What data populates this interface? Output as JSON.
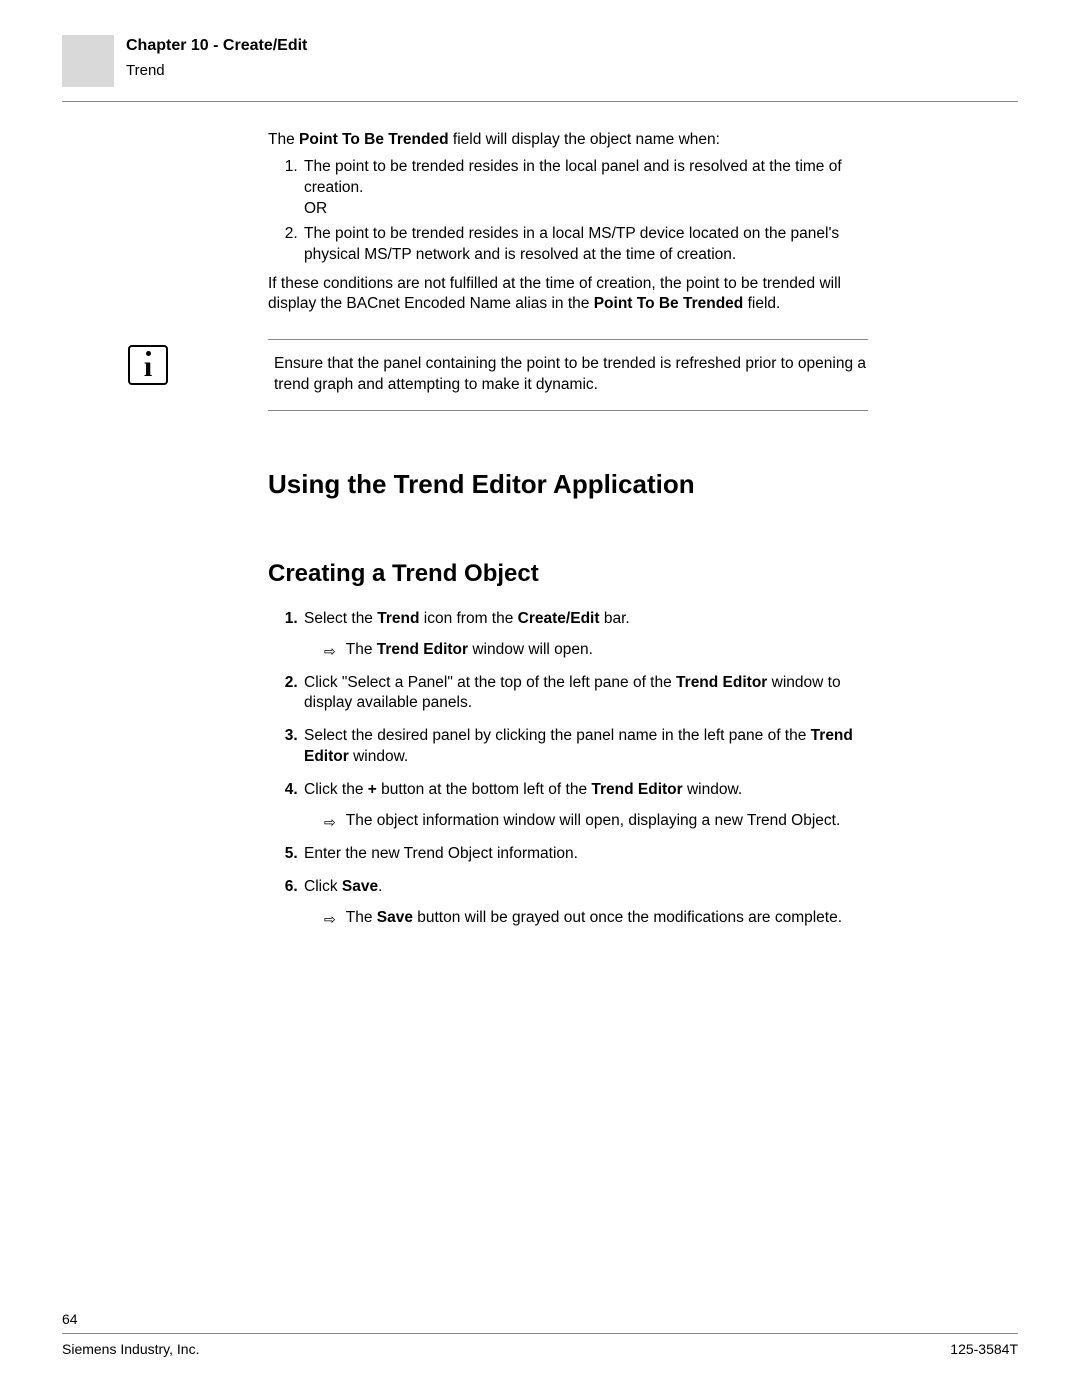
{
  "header": {
    "chapter": "Chapter 10 - Create/Edit",
    "sub": "Trend"
  },
  "intro": {
    "lead_pre": "The ",
    "lead_bold": "Point To Be Trended",
    "lead_post": " field will display the object name when:",
    "li1": "The point to be trended resides in the local panel and is resolved at the time of creation.",
    "or": "OR",
    "li2": "The point to be trended resides in a local MS/TP device located on the panel's physical MS/TP network and is resolved at the time of creation.",
    "followup_pre": "If these conditions are not fulfilled at the time of creation, the point to be trended will display the BACnet Encoded Name alias in the ",
    "followup_bold": "Point To Be Trended",
    "followup_post": " field."
  },
  "note": {
    "text": "Ensure that the panel containing the point to be trended is refreshed prior to opening a trend graph and attempting to make it dynamic."
  },
  "headings": {
    "using": "Using the Trend Editor Application",
    "creating": "Creating a Trend Object"
  },
  "steps": {
    "s1_a": "Select the ",
    "s1_b": "Trend",
    "s1_c": " icon from the ",
    "s1_d": "Create/Edit",
    "s1_e": " bar.",
    "s1_sub_a": "The ",
    "s1_sub_b": "Trend Editor",
    "s1_sub_c": " window will open.",
    "s2_a": "Click \"Select a Panel\" at the top of the left pane of the ",
    "s2_b": "Trend Editor",
    "s2_c": " window to display available panels.",
    "s3_a": "Select the desired panel by clicking the panel name in the left pane of the ",
    "s3_b": "Trend Editor",
    "s3_c": " window.",
    "s4_a": "Click the ",
    "s4_b": "+",
    "s4_c": " button at the bottom left of the ",
    "s4_d": "Trend Editor",
    "s4_e": " window.",
    "s4_sub": "The object information window will open, displaying a new Trend Object.",
    "s5": "Enter the new Trend Object information.",
    "s6_a": "Click ",
    "s6_b": "Save",
    "s6_c": ".",
    "s6_sub_a": "The ",
    "s6_sub_b": "Save",
    "s6_sub_c": " button will be grayed out once the modifications are complete."
  },
  "footer": {
    "page": "64",
    "left": "Siemens Industry, Inc.",
    "right": "125-3584T"
  }
}
